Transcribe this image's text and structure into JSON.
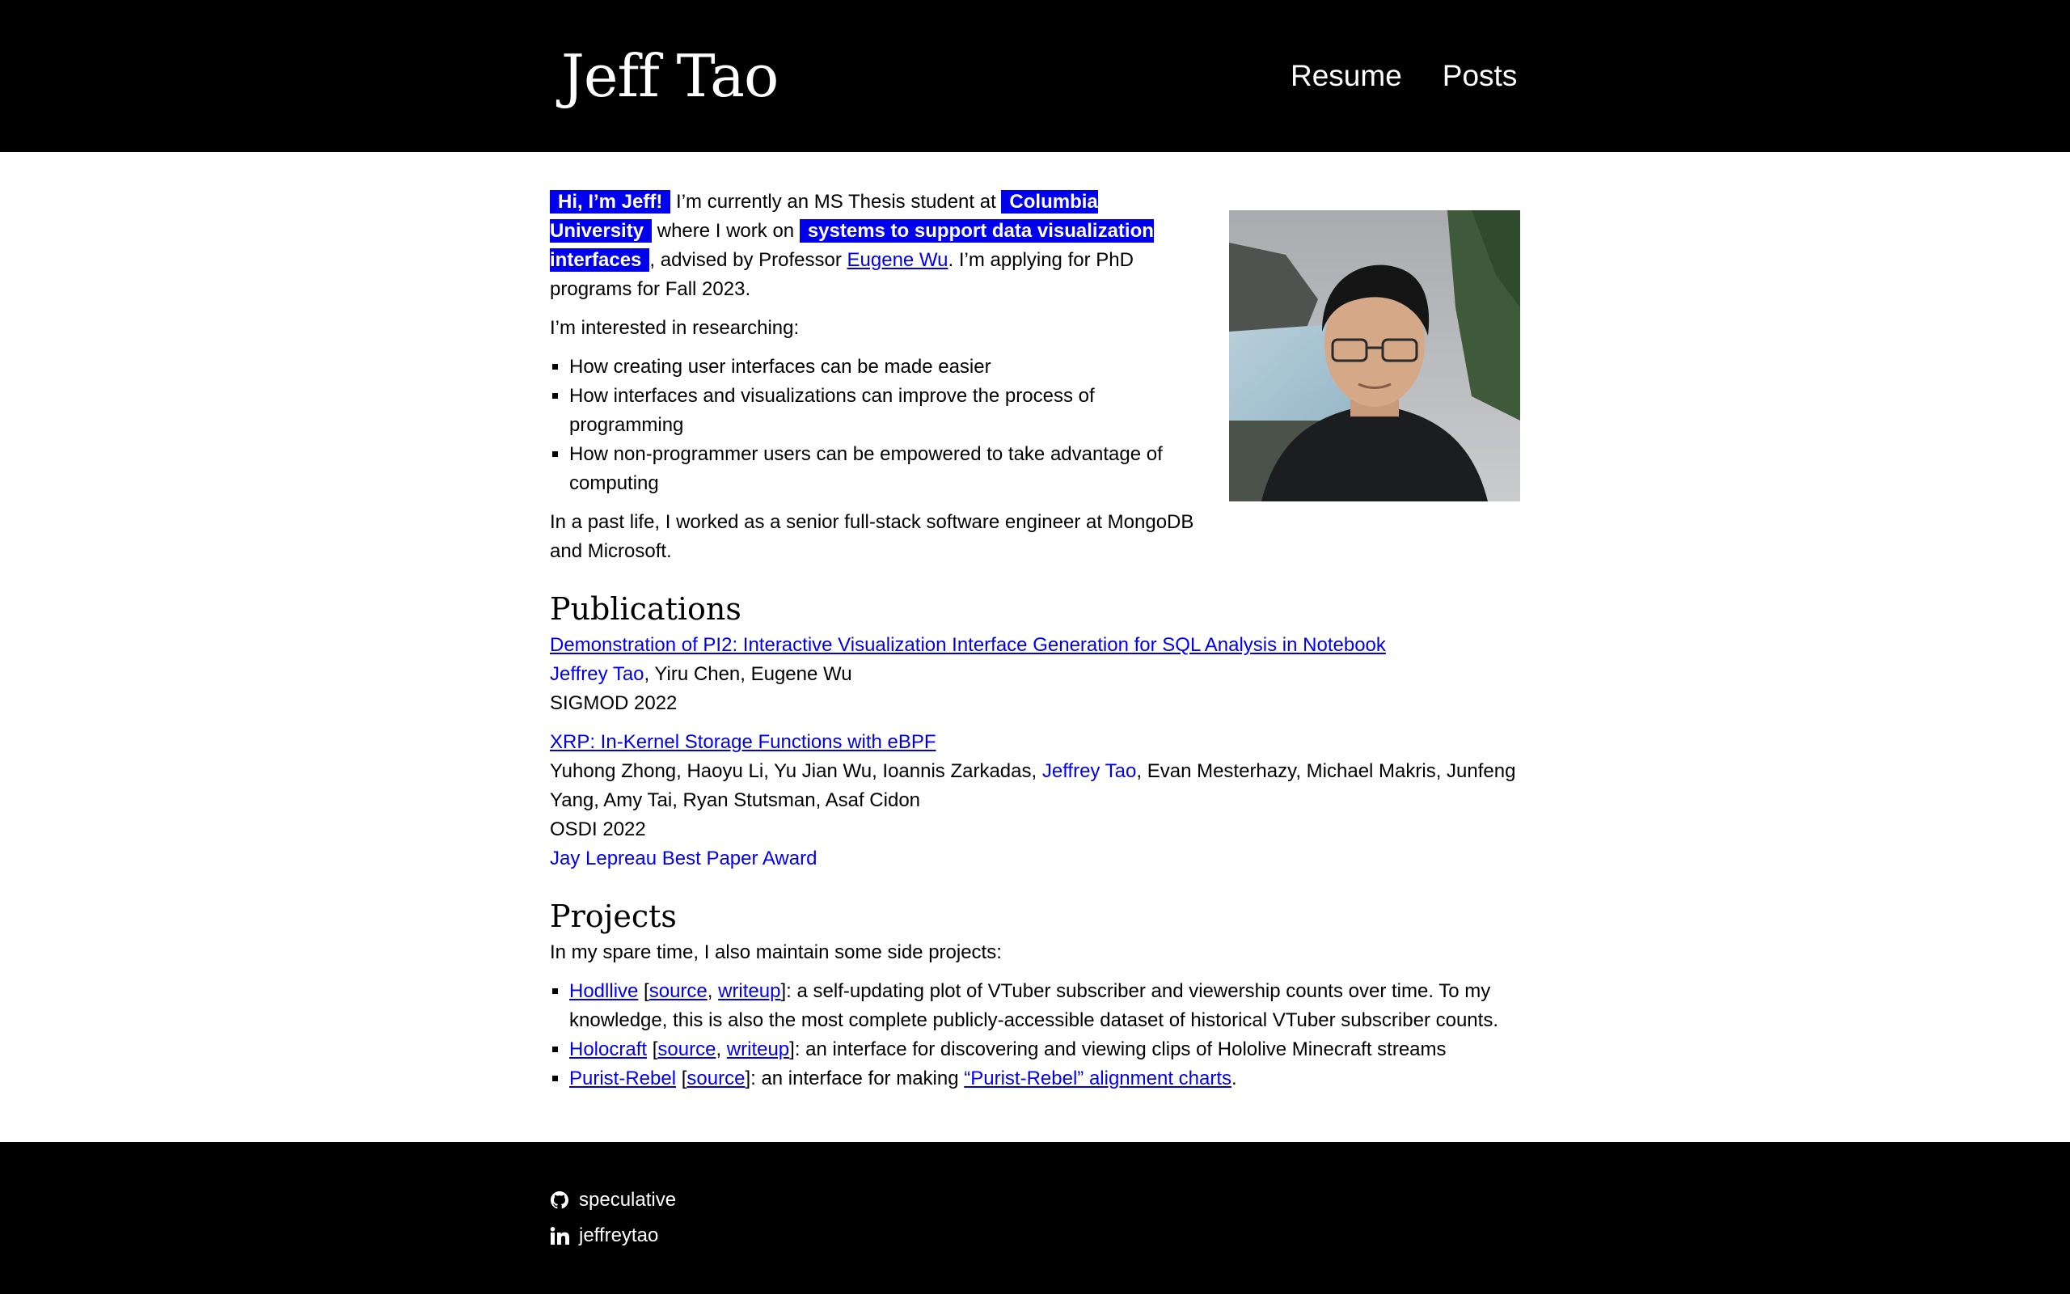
{
  "header": {
    "site_title": "Jeff Tao",
    "nav": [
      {
        "label": "Resume"
      },
      {
        "label": "Posts"
      }
    ]
  },
  "intro": {
    "hl_hi": "Hi, I’m Jeff!",
    "t1": " I’m currently an MS Thesis student at ",
    "hl_columbia": "Columbia University",
    "t2": " where I work on ",
    "hl_systems": "systems to support data visualization interfaces",
    "t3": ", advised by Professor ",
    "advisor_link": "Eugene Wu",
    "t4": ". I’m applying for PhD programs for Fall 2023.",
    "interests_intro": "I’m interested in researching:",
    "interests": [
      "How creating user interfaces can be made easier",
      "How interfaces and visualizations can improve the process of programming",
      "How non-programmer users can be empowered to take advantage of computing"
    ],
    "past_life": "In a past life, I worked as a senior full-stack software engineer at MongoDB and Microsoft."
  },
  "publications": {
    "heading": "Publications",
    "items": [
      {
        "title": "Demonstration of PI2: Interactive Visualization Interface Generation for SQL Analysis in Notebook",
        "authors_before": "",
        "self": "Jeffrey Tao",
        "authors_after": ", Yiru Chen, Eugene Wu",
        "venue": "SIGMOD 2022",
        "award": ""
      },
      {
        "title": "XRP: In-Kernel Storage Functions with eBPF",
        "authors_before": "Yuhong Zhong, Haoyu Li, Yu Jian Wu, Ioannis Zarkadas, ",
        "self": "Jeffrey Tao",
        "authors_after": ", Evan Mesterhazy, Michael Makris, Junfeng Yang, Amy Tai, Ryan Stutsman, Asaf Cidon",
        "venue": "OSDI 2022",
        "award": "Jay Lepreau Best Paper Award"
      }
    ]
  },
  "projects": {
    "heading": "Projects",
    "intro": "In my spare time, I also maintain some side projects:",
    "items": [
      {
        "name": "Hodllive",
        "source": "source",
        "writeup": "writeup",
        "desc": ": a self-updating plot of VTuber subscriber and viewership counts over time. To my knowledge, this is also the most complete publicly-accessible dataset of historical VTuber subscriber counts."
      },
      {
        "name": "Holocraft",
        "source": "source",
        "writeup": "writeup",
        "desc": ": an interface for discovering and viewing clips of Hololive Minecraft streams"
      },
      {
        "name": "Purist-Rebel",
        "source": "source",
        "desc_before": ": an interface for making ",
        "chart_link": "“Purist-Rebel” alignment charts",
        "desc_after": "."
      }
    ]
  },
  "footer": {
    "github": {
      "icon": "github-icon",
      "handle": "speculative"
    },
    "linkedin": {
      "icon": "linkedin-icon",
      "handle": "jeffreytao"
    }
  },
  "colors": {
    "accent": "#0000ee",
    "header_bg": "#000000",
    "footer_bg": "#000000"
  }
}
